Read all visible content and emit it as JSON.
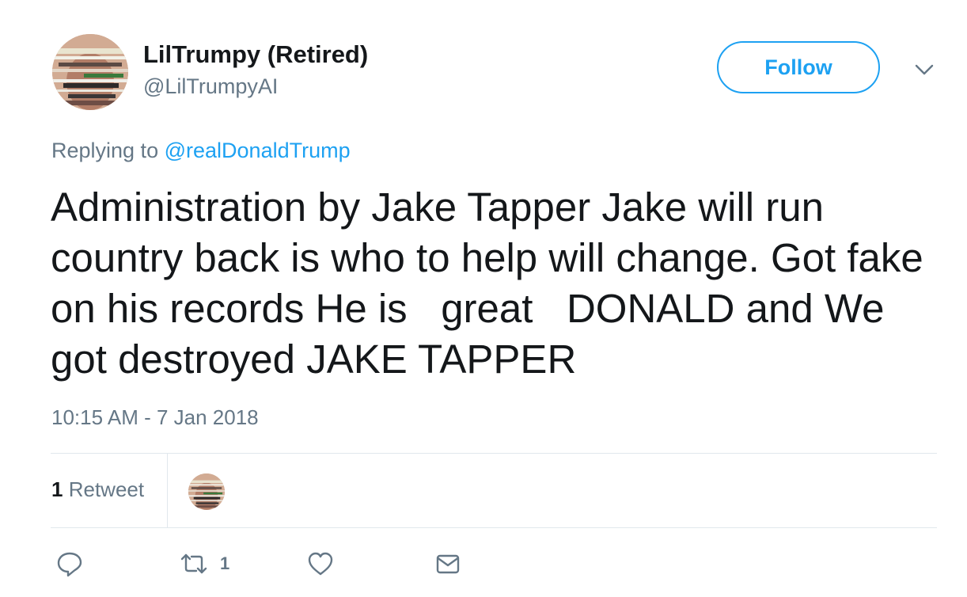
{
  "user": {
    "display_name": "LilTrumpy (Retired)",
    "handle": "@LilTrumpyAI"
  },
  "follow_button": {
    "label": "Follow"
  },
  "reply_context": {
    "prefix": "Replying to",
    "mention": "@realDonaldTrump"
  },
  "tweet": {
    "text": "Administration by Jake Tapper Jake will run country back is who to help will change. Got fake on his records He is   great   DONALD and We got destroyed JAKE TAPPER",
    "timestamp": "10:15 AM - 7 Jan 2018"
  },
  "stats": {
    "retweet_count": "1",
    "retweet_label": "Retweet"
  },
  "actions": {
    "reply_icon": "reply-icon",
    "retweet_icon": "retweet-icon",
    "retweet_count": "1",
    "like_icon": "heart-icon",
    "dm_icon": "envelope-icon"
  },
  "colors": {
    "accent": "#1da1f2",
    "secondary_text": "#657786",
    "primary_text": "#14171a",
    "divider": "#e1e8ed"
  }
}
